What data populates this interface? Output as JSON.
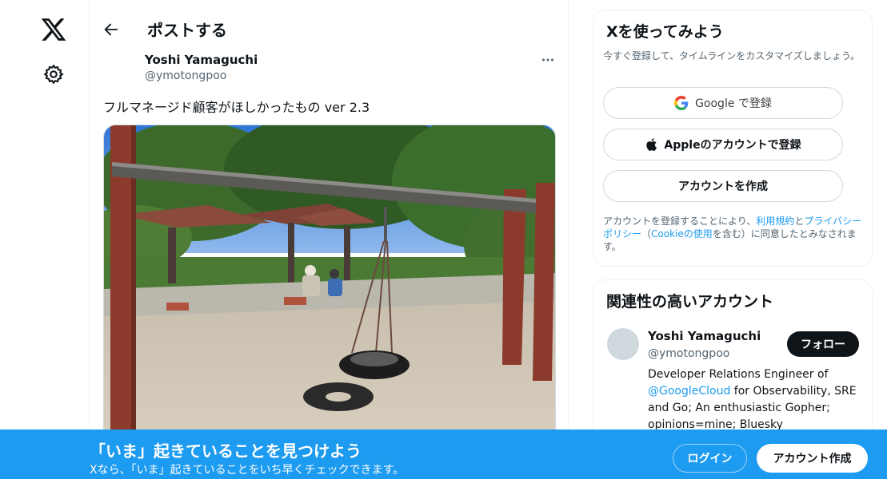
{
  "brand": {
    "logo": "x-logo-icon",
    "accent": "#1d9bf0"
  },
  "nav": {
    "settings_icon": "gear-icon"
  },
  "header": {
    "title": "ポストする",
    "back_icon": "arrow-left-icon"
  },
  "post": {
    "author_name": "Yoshi Yamaguchi",
    "author_handle": "@ymotongpoo",
    "more_icon": "ellipsis-icon",
    "text": "フルマネージド顧客がほしかったもの ver 2.3",
    "photo_alt": "Playground swing with a tire seat under a metal bar in a park"
  },
  "signup_card": {
    "title": "Xを使ってみよう",
    "subtitle": "今すぐ登録して、タイムラインをカスタマイズしましょう。",
    "google_label": "Google で登録",
    "apple_label": "Appleのアカウントで登録",
    "create_label": "アカウントを作成",
    "terms_prefix": "アカウントを登録することにより、",
    "terms_link": "利用規約",
    "terms_and": "と",
    "privacy_link": "プライバシーポリシー",
    "terms_paren_open": "（",
    "cookie_link": "Cookieの使用",
    "terms_suffix": "を含む）に同意したとみなされます。"
  },
  "related": {
    "title": "関連性の高いアカウント",
    "name": "Yoshi Yamaguchi",
    "handle": "@ymotongpoo",
    "follow_label": "フォロー",
    "bio_prefix": "Developer Relations Engineer of ",
    "bio_link": "@GoogleCloud",
    "bio_suffix": " for Observability, SRE and Go; An enthusiastic Gopher; opinions=mine; Bluesky"
  },
  "banner": {
    "title": "「いま」起きていることを見つけよう",
    "subtitle": "Xなら、「いま」起きていることをいち早くチェックできます。",
    "login_label": "ログイン",
    "signup_label": "アカウント作成"
  }
}
